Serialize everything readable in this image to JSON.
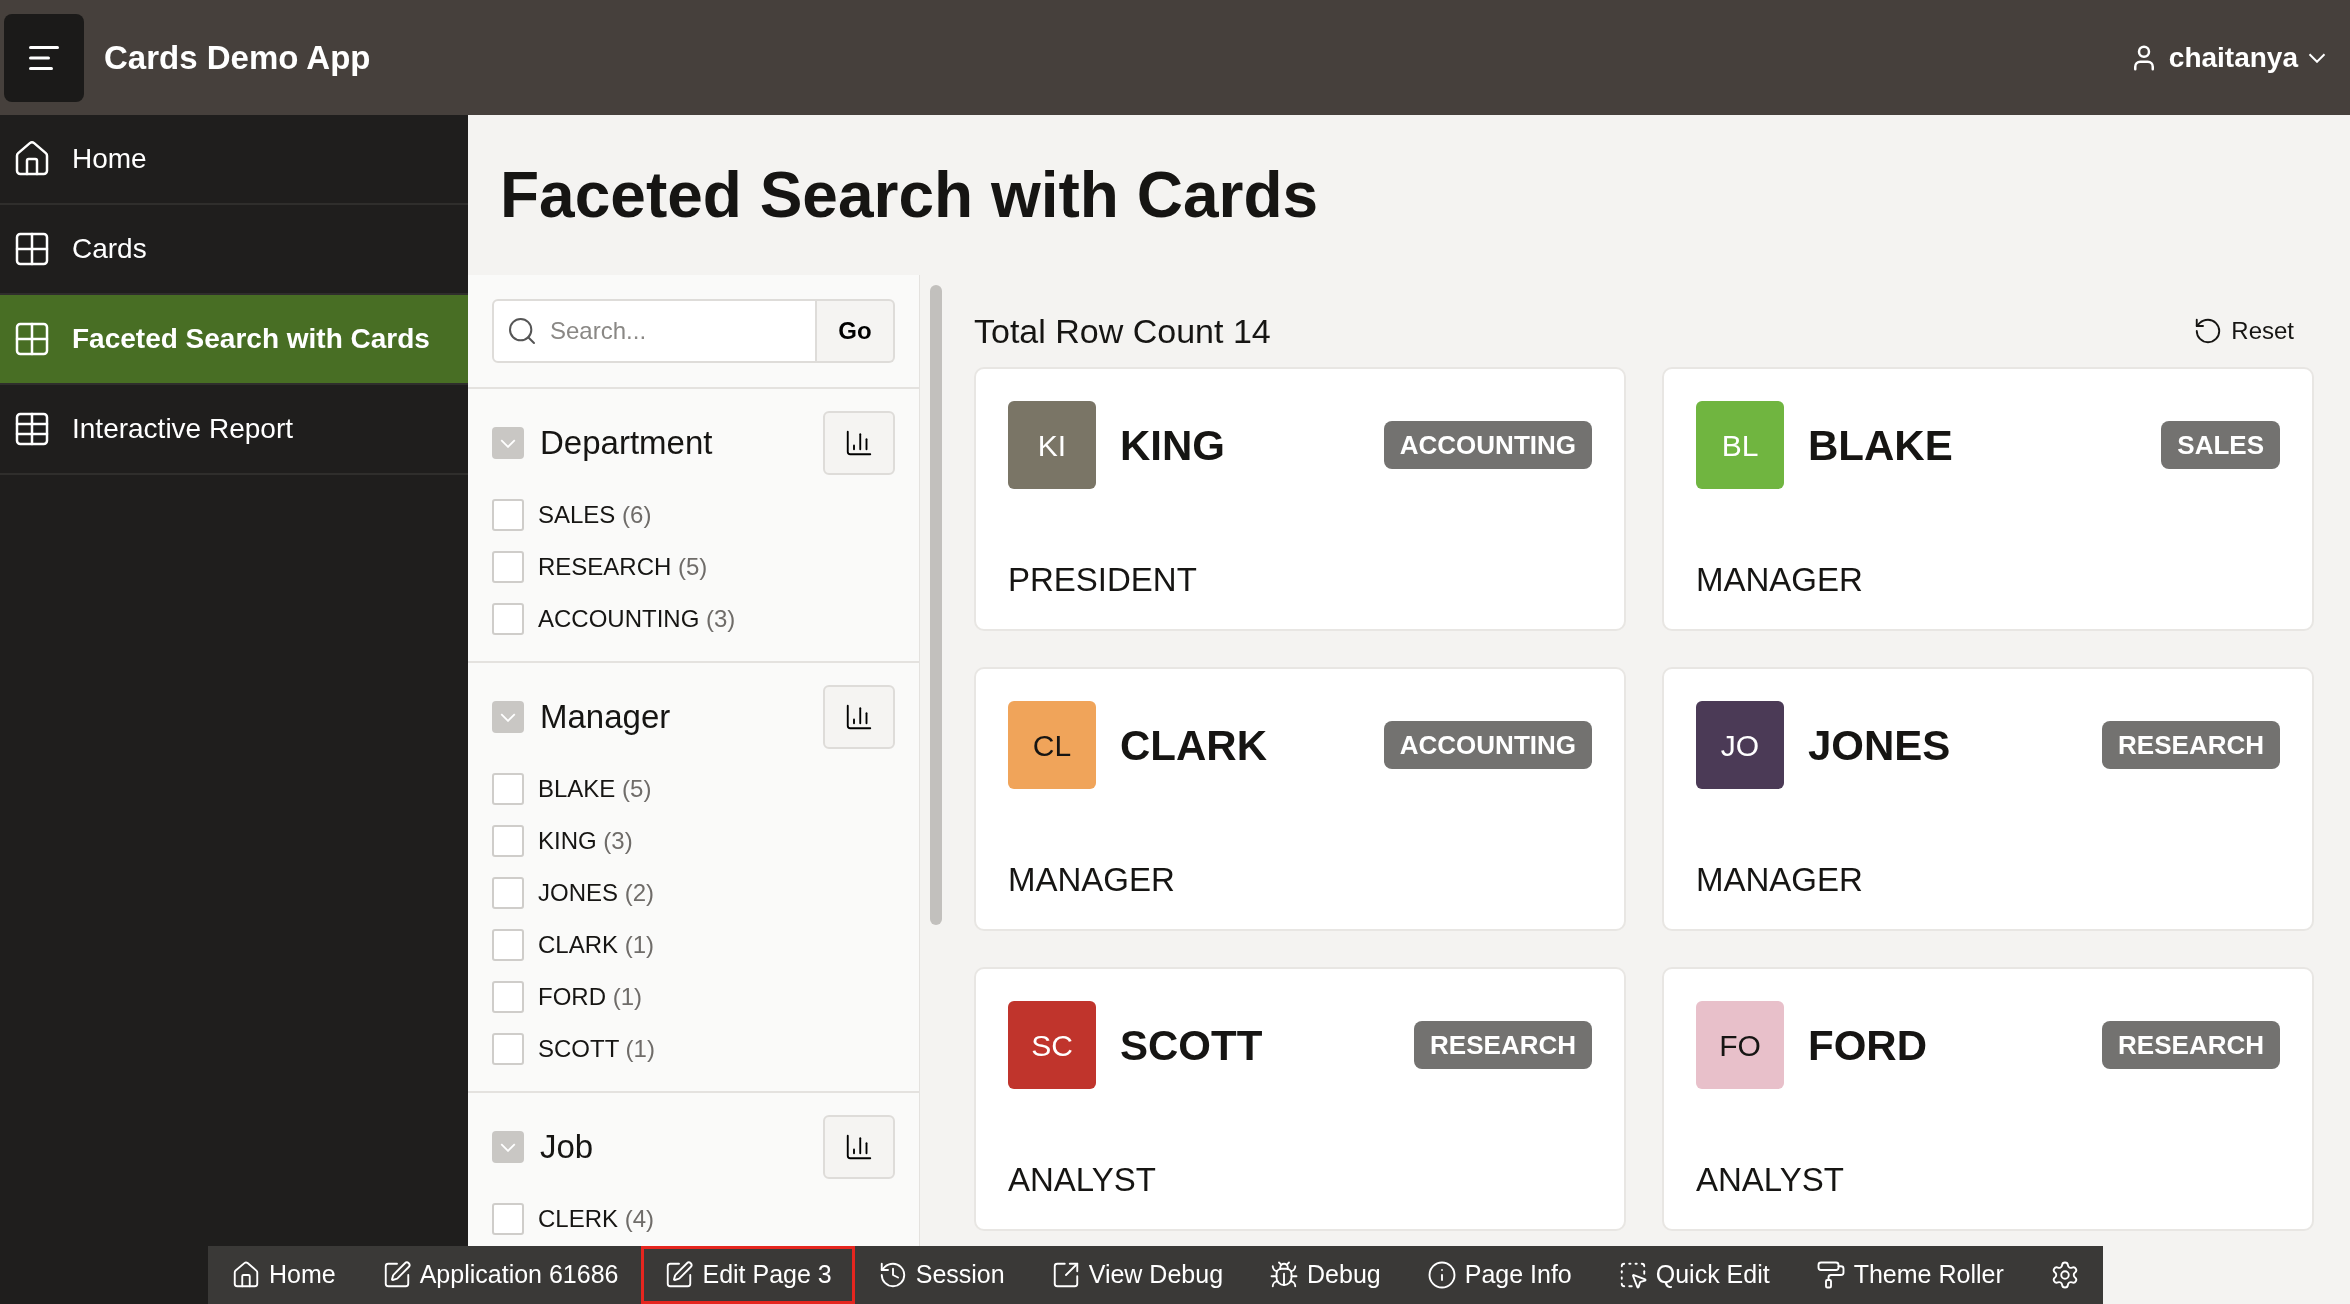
{
  "header": {
    "app_title": "Cards Demo App",
    "user": "chaitanya"
  },
  "sidebar": {
    "items": [
      {
        "label": "Home",
        "kind": "home",
        "selected": false
      },
      {
        "label": "Cards",
        "kind": "grid",
        "selected": false
      },
      {
        "label": "Faceted Search with Cards",
        "kind": "grid",
        "selected": true
      },
      {
        "label": "Interactive Report",
        "kind": "table",
        "selected": false
      }
    ]
  },
  "page_title": "Faceted Search with Cards",
  "facets": {
    "search": {
      "placeholder": "Search...",
      "button": "Go"
    },
    "groups": [
      {
        "title": "Department",
        "expanded": true,
        "options": [
          {
            "label": "SALES",
            "count": "(6)",
            "checked": false
          },
          {
            "label": "RESEARCH",
            "count": "(5)",
            "checked": false
          },
          {
            "label": "ACCOUNTING",
            "count": "(3)",
            "checked": false
          }
        ]
      },
      {
        "title": "Manager",
        "expanded": true,
        "options": [
          {
            "label": "BLAKE",
            "count": "(5)",
            "checked": false
          },
          {
            "label": "KING",
            "count": "(3)",
            "checked": false
          },
          {
            "label": "JONES",
            "count": "(2)",
            "checked": false
          },
          {
            "label": "CLARK",
            "count": "(1)",
            "checked": false
          },
          {
            "label": "FORD",
            "count": "(1)",
            "checked": false
          },
          {
            "label": "SCOTT",
            "count": "(1)",
            "checked": false
          }
        ]
      },
      {
        "title": "Job",
        "expanded": true,
        "options": [
          {
            "label": "CLERK",
            "count": "(4)",
            "checked": false
          }
        ]
      }
    ]
  },
  "results": {
    "total": "Total Row Count 14",
    "reset": "Reset",
    "cards": [
      {
        "initials": "KI",
        "name": "KING",
        "department": "ACCOUNTING",
        "job": "PRESIDENT",
        "color": "#7a7566"
      },
      {
        "initials": "BL",
        "name": "BLAKE",
        "department": "SALES",
        "job": "MANAGER",
        "color": "#70b540"
      },
      {
        "initials": "CL",
        "name": "CLARK",
        "department": "ACCOUNTING",
        "job": "MANAGER",
        "color": "#f0a45a"
      },
      {
        "initials": "JO",
        "name": "JONES",
        "department": "RESEARCH",
        "job": "MANAGER",
        "color": "#4b3a56"
      },
      {
        "initials": "SC",
        "name": "SCOTT",
        "department": "RESEARCH",
        "job": "ANALYST",
        "color": "#c0342c"
      },
      {
        "initials": "FO",
        "name": "FORD",
        "department": "RESEARCH",
        "job": "ANALYST",
        "color": "#e8c0ca"
      }
    ]
  },
  "dev_toolbar": [
    {
      "label": "Home",
      "kind": "home",
      "selected": false
    },
    {
      "label": "Application 61686",
      "kind": "edit",
      "selected": false
    },
    {
      "label": "Edit Page 3",
      "kind": "edit",
      "selected": true
    },
    {
      "label": "Session",
      "kind": "session",
      "selected": false
    },
    {
      "label": "View Debug",
      "kind": "view",
      "selected": false
    },
    {
      "label": "Debug",
      "kind": "debug",
      "selected": false
    },
    {
      "label": "Page Info",
      "kind": "info",
      "selected": false
    },
    {
      "label": "Quick Edit",
      "kind": "quick",
      "selected": false
    },
    {
      "label": "Theme Roller",
      "kind": "theme",
      "selected": false
    },
    {
      "kind": "settings",
      "selected": false
    }
  ]
}
